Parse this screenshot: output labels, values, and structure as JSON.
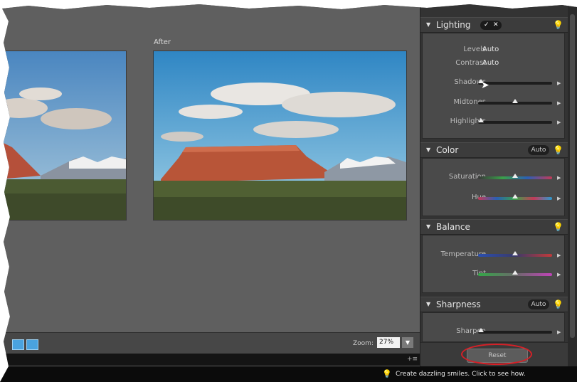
{
  "preview": {
    "after_label": "After",
    "zoom_label": "Zoom:",
    "zoom_value": "27%"
  },
  "status": {
    "tip": "Create dazzling smiles. Click to see how."
  },
  "panel": {
    "lighting": {
      "title": "Lighting",
      "levels_label": "Levels",
      "levels_value": "Auto",
      "contrast_label": "Contrast",
      "contrast_value": "Auto",
      "sliders": [
        {
          "label": "Shadows",
          "value": 0.0
        },
        {
          "label": "Midtones",
          "value": 0.5
        },
        {
          "label": "Highlights",
          "value": 0.0
        }
      ]
    },
    "color": {
      "title": "Color",
      "auto_label": "Auto",
      "sliders": [
        {
          "label": "Saturation",
          "value": 0.5
        },
        {
          "label": "Hue",
          "value": 0.5
        }
      ]
    },
    "balance": {
      "title": "Balance",
      "sliders": [
        {
          "label": "Temperature",
          "value": 0.5
        },
        {
          "label": "Tint",
          "value": 0.5
        }
      ]
    },
    "sharpness": {
      "title": "Sharpness",
      "auto_label": "Auto",
      "sliders": [
        {
          "label": "Sharpen",
          "value": 0.0
        }
      ]
    },
    "reset_label": "Reset"
  },
  "colors": {
    "accent_red": "#d72027",
    "panel_bg": "#333333",
    "preview_bg": "#5f5f5f"
  }
}
